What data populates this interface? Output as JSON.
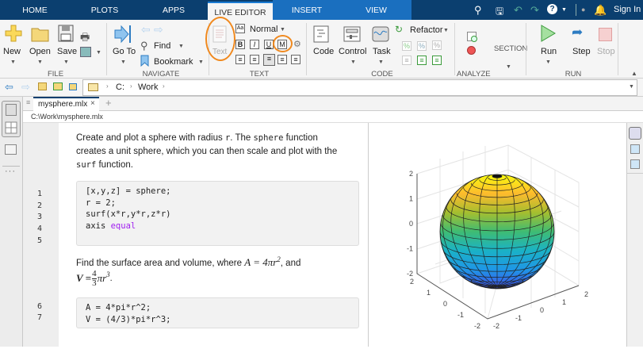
{
  "tabs": {
    "home": "HOME",
    "plots": "PLOTS",
    "apps": "APPS",
    "live_editor": "LIVE EDITOR",
    "insert": "INSERT",
    "view": "VIEW"
  },
  "toolbar_right": {
    "sign_in": "Sign In"
  },
  "ribbon": {
    "file": {
      "new": "New",
      "open": "Open",
      "save": "Save",
      "group": "FILE"
    },
    "navigate": {
      "goto": "Go To",
      "find": "Find",
      "bookmark": "Bookmark",
      "group": "NAVIGATE"
    },
    "text": {
      "text": "Text",
      "style": "Normal",
      "bold": "B",
      "italic": "I",
      "underline": "U",
      "mono": "M",
      "group": "TEXT"
    },
    "code": {
      "code": "Code",
      "control": "Control",
      "task": "Task",
      "refactor": "Refactor",
      "group": "CODE"
    },
    "analyze": {
      "group": "ANALYZE"
    },
    "section": {
      "label": "SECTION"
    },
    "run": {
      "run": "Run",
      "step": "Step",
      "stop": "Stop",
      "group": "RUN"
    }
  },
  "address": {
    "segments": [
      "C:",
      "Work"
    ]
  },
  "document": {
    "tab": "mysphere.mlx",
    "path": "C:\\Work\\mysphere.mlx"
  },
  "content": {
    "para1": {
      "a": "Create and plot a sphere with radius ",
      "b": "r",
      "c": ". The ",
      "d": "sphere",
      "e": " function creates a unit sphere, which you can then scale and plot with the ",
      "f": "surf",
      "g": " function."
    },
    "code1": {
      "lines": [
        "[x,y,z] = sphere;",
        "r = 2;",
        "surf(x*r,y*r,z*r)",
        "axis "
      ],
      "keyword": "equal",
      "line_numbers": [
        "1",
        "2",
        "3",
        "4",
        "5"
      ]
    },
    "para2": {
      "a": "Find the surface area and volume, where ",
      "eqA": "A = 4πr",
      "sup2": "2",
      "b": ", and",
      "eqV": "V = ",
      "num": "4",
      "den": "3",
      "pir": "πr",
      "sup3": "3",
      "end": "."
    },
    "code2": {
      "lines": [
        "A = 4*pi*r^2;",
        "V = (4/3)*pi*r^3;"
      ],
      "line_numbers": [
        "6",
        "7"
      ]
    }
  },
  "figure": {
    "z_ticks": [
      "2",
      "1",
      "0",
      "-1",
      "-2"
    ],
    "y_ticks": [
      "2",
      "1",
      "0",
      "-1",
      "-2"
    ],
    "x_ticks": [
      "-2",
      "-1",
      "0",
      "1",
      "2"
    ],
    "highlight_color": "#f0891e",
    "colormap": [
      "#f9fb0e",
      "#fdbb2d",
      "#a5be2f",
      "#3fbc73",
      "#1ab2c6",
      "#1f96e6",
      "#3e4fe8"
    ]
  }
}
